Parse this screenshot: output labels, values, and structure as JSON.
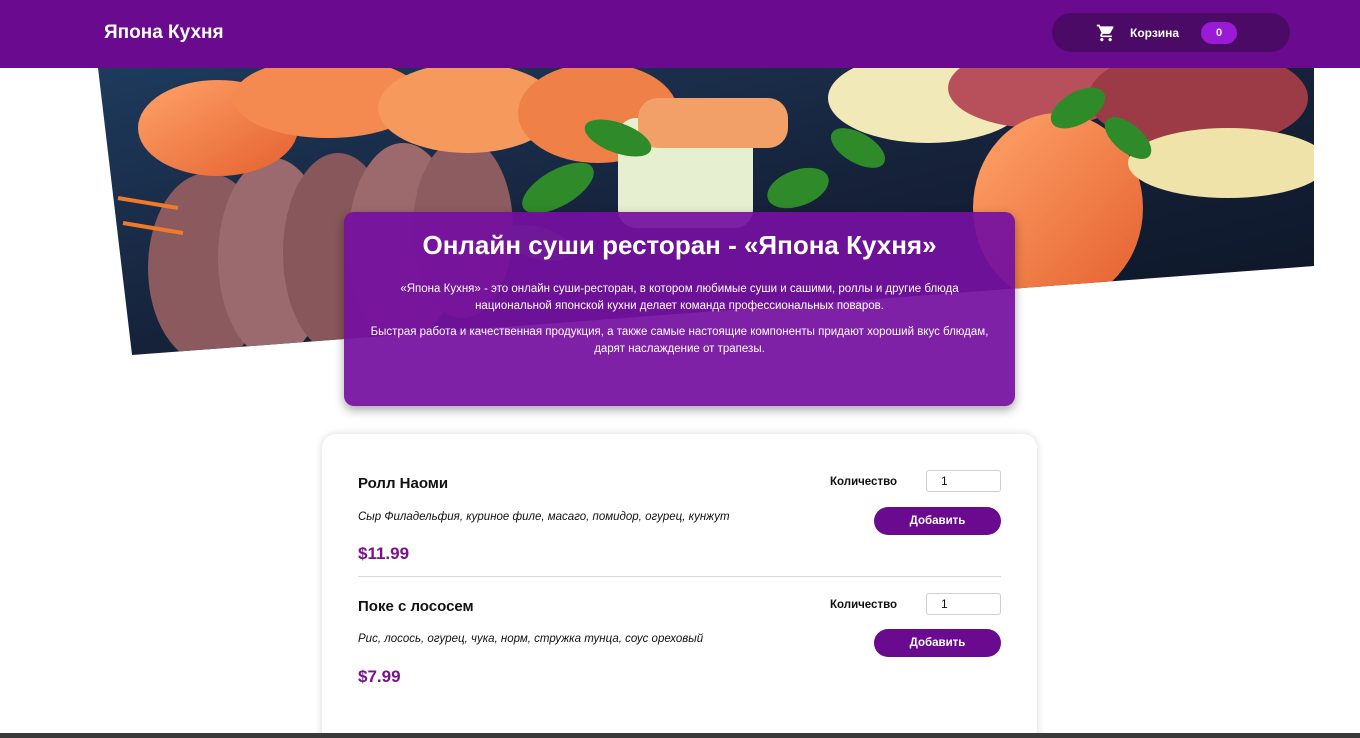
{
  "header": {
    "brand": "Япона Кухня",
    "cart_label": "Корзина",
    "cart_count": "0",
    "cart_icon": "cart-icon"
  },
  "hero": {
    "title": "Онлайн суши ресторан - «Япона Кухня»",
    "paragraph1": "«Япона Кухня» - это онлайн суши-ресторан, в котором любимые суши и сашими, роллы и другие блюда национальной японской кухни делает команда профессиональных поваров.",
    "paragraph2": "Быстрая работа и качественная продукция, а также самые настоящие компоненты придают хороший вкус блюдам, дарят наслаждение от трапезы."
  },
  "menu": {
    "items": [
      {
        "name": "Ролл Наоми",
        "description": "Сыр Филадельфия, куриное филе, масаго, помидор, огурец, кунжут",
        "price": "$11.99",
        "qty_label": "Количество",
        "qty_value": "1",
        "add_label": "Добавить"
      },
      {
        "name": "Поке с лососем",
        "description": "Рис, лосось, огурец, чука, норм, стружка тунца, соус ореховый",
        "price": "$7.99",
        "qty_label": "Количество",
        "qty_value": "1",
        "add_label": "Добавить"
      }
    ]
  },
  "colors": {
    "header_bg": "#6a0a8e",
    "accent": "#7a118f",
    "badge": "#9a1bd6"
  }
}
